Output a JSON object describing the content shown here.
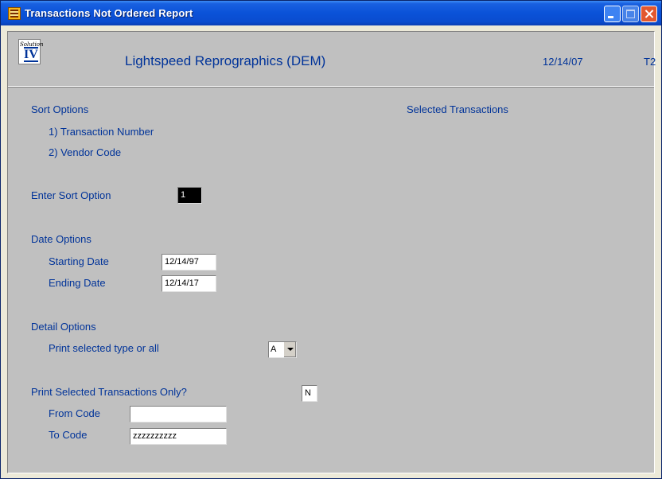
{
  "window": {
    "title": "Transactions Not Ordered Report"
  },
  "header": {
    "logo_script": "Solution",
    "logo_numeral": "IV",
    "company": "Lightspeed Reprographics (DEM)",
    "date": "12/14/07",
    "terminal": "T2"
  },
  "sort": {
    "heading": "Sort Options",
    "option1": "1) Transaction Number",
    "option2": "2) Vendor Code",
    "enter_label": "Enter Sort Option",
    "enter_value": "1"
  },
  "selected": {
    "heading": "Selected Transactions"
  },
  "dates": {
    "heading": "Date Options",
    "start_label": "Starting Date",
    "start_value": "12/14/97",
    "end_label": "Ending Date",
    "end_value": "12/14/17"
  },
  "detail": {
    "heading": "Detail Options",
    "type_label": "Print selected type or all",
    "type_value": "A"
  },
  "print_selected": {
    "label": "Print Selected Transactions Only?",
    "value": "N",
    "from_label": "From Code",
    "from_value": "",
    "to_label": "To Code",
    "to_value": "zzzzzzzzzz"
  },
  "colors": {
    "label_blue": "#003399",
    "titlebar_blue": "#0a52d8",
    "panel_gray": "#c0c0c0"
  }
}
